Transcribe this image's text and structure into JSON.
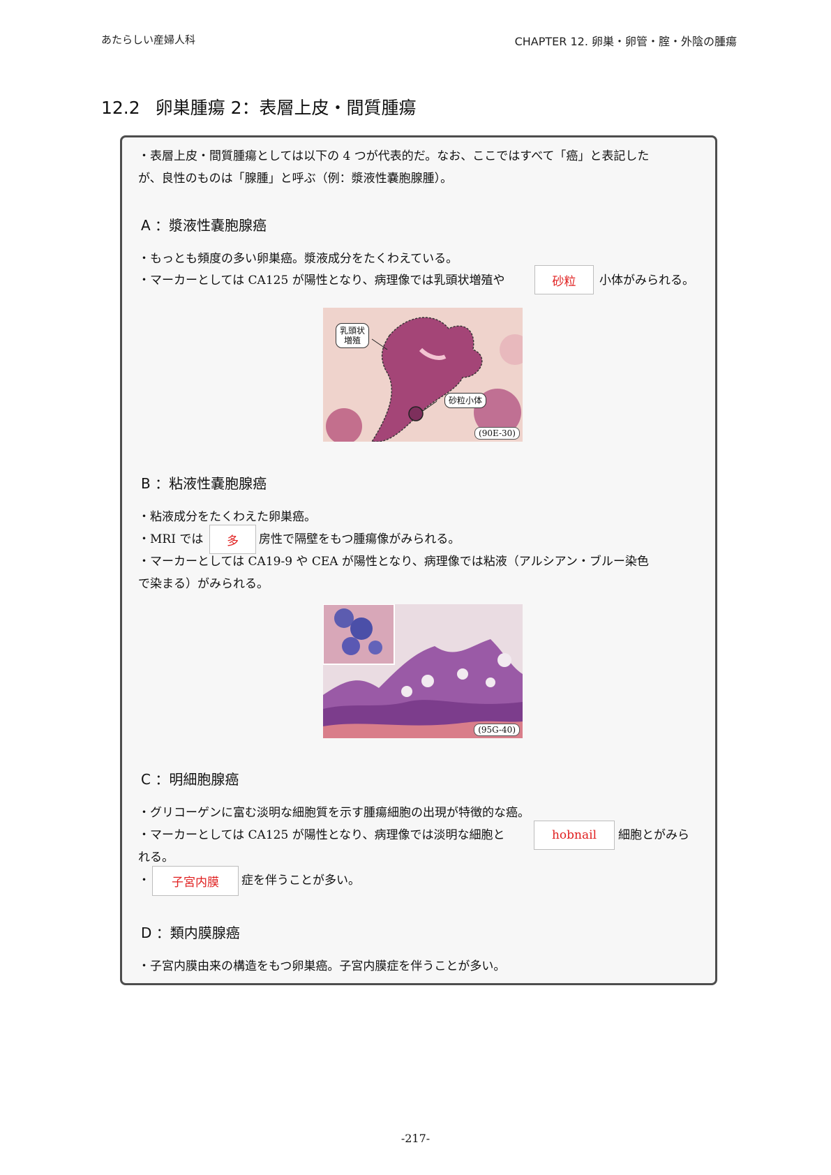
{
  "header": {
    "left": "あたらしい産婦人科",
    "right": "CHAPTER 12. 卵巣・卵管・腟・外陰の腫瘍"
  },
  "section": {
    "number": "12.2",
    "title": "卵巣腫瘍 2：表層上皮・間質腫瘍"
  },
  "intro": {
    "line1": "・表層上皮・間質腫瘍としては以下の 4 つが代表的だ。なお、ここではすべて「癌」と表記した",
    "line2": "が、良性のものは「腺腫」と呼ぶ（例：漿液性嚢胞腺腫）。"
  },
  "sectionA": {
    "heading": "A ：漿液性嚢胞腺癌",
    "line1": "・もっとも頻度の多い卵巣癌。漿液成分をたくわえている。",
    "line2_pre": "・マーカーとしては CA125 が陽性となり、病理像では乳頭状増殖や",
    "blank": "砂粒",
    "line2_post": "小体がみられる。",
    "figure": {
      "label_papillary": "乳頭状\n増殖",
      "label_psammoma": "砂粒小体",
      "code": "(90E-30)"
    }
  },
  "sectionB": {
    "heading": "B ：粘液性嚢胞腺癌",
    "line1": "・粘液成分をたくわえた卵巣癌。",
    "line2_pre": "・MRI では",
    "blank": "多",
    "line2_post": "房性で隔壁をもつ腫瘍像がみられる。",
    "line3": "・マーカーとしては CA19-9 や CEA が陽性となり、病理像では粘液（アルシアン・ブルー染色",
    "line4": "で染まる）がみられる。",
    "figure": {
      "code": "(95G-40)"
    }
  },
  "sectionC": {
    "heading": "C ：明細胞腺癌",
    "line1": "・グリコーゲンに富む淡明な細胞質を示す腫瘍細胞の出現が特徴的な癌。",
    "line2_pre": "・マーカーとしては CA125 が陽性となり、病理像では淡明な細胞と",
    "blank1": "hobnail",
    "line2_post": "細胞とがみら",
    "line3": "れる。",
    "line4_pre": "・",
    "blank2": "子宮内膜",
    "line4_post": "症を伴うことが多い。"
  },
  "sectionD": {
    "heading": "D ：類内膜腺癌",
    "line1": "・子宮内膜由来の構造をもつ卵巣癌。子宮内膜症を伴うことが多い。"
  },
  "footer": {
    "page_number": "-217-"
  },
  "colors": {
    "blank_text": "#e02020",
    "box_border": "#4d4d4d",
    "box_fill": "#f7f7f7"
  }
}
